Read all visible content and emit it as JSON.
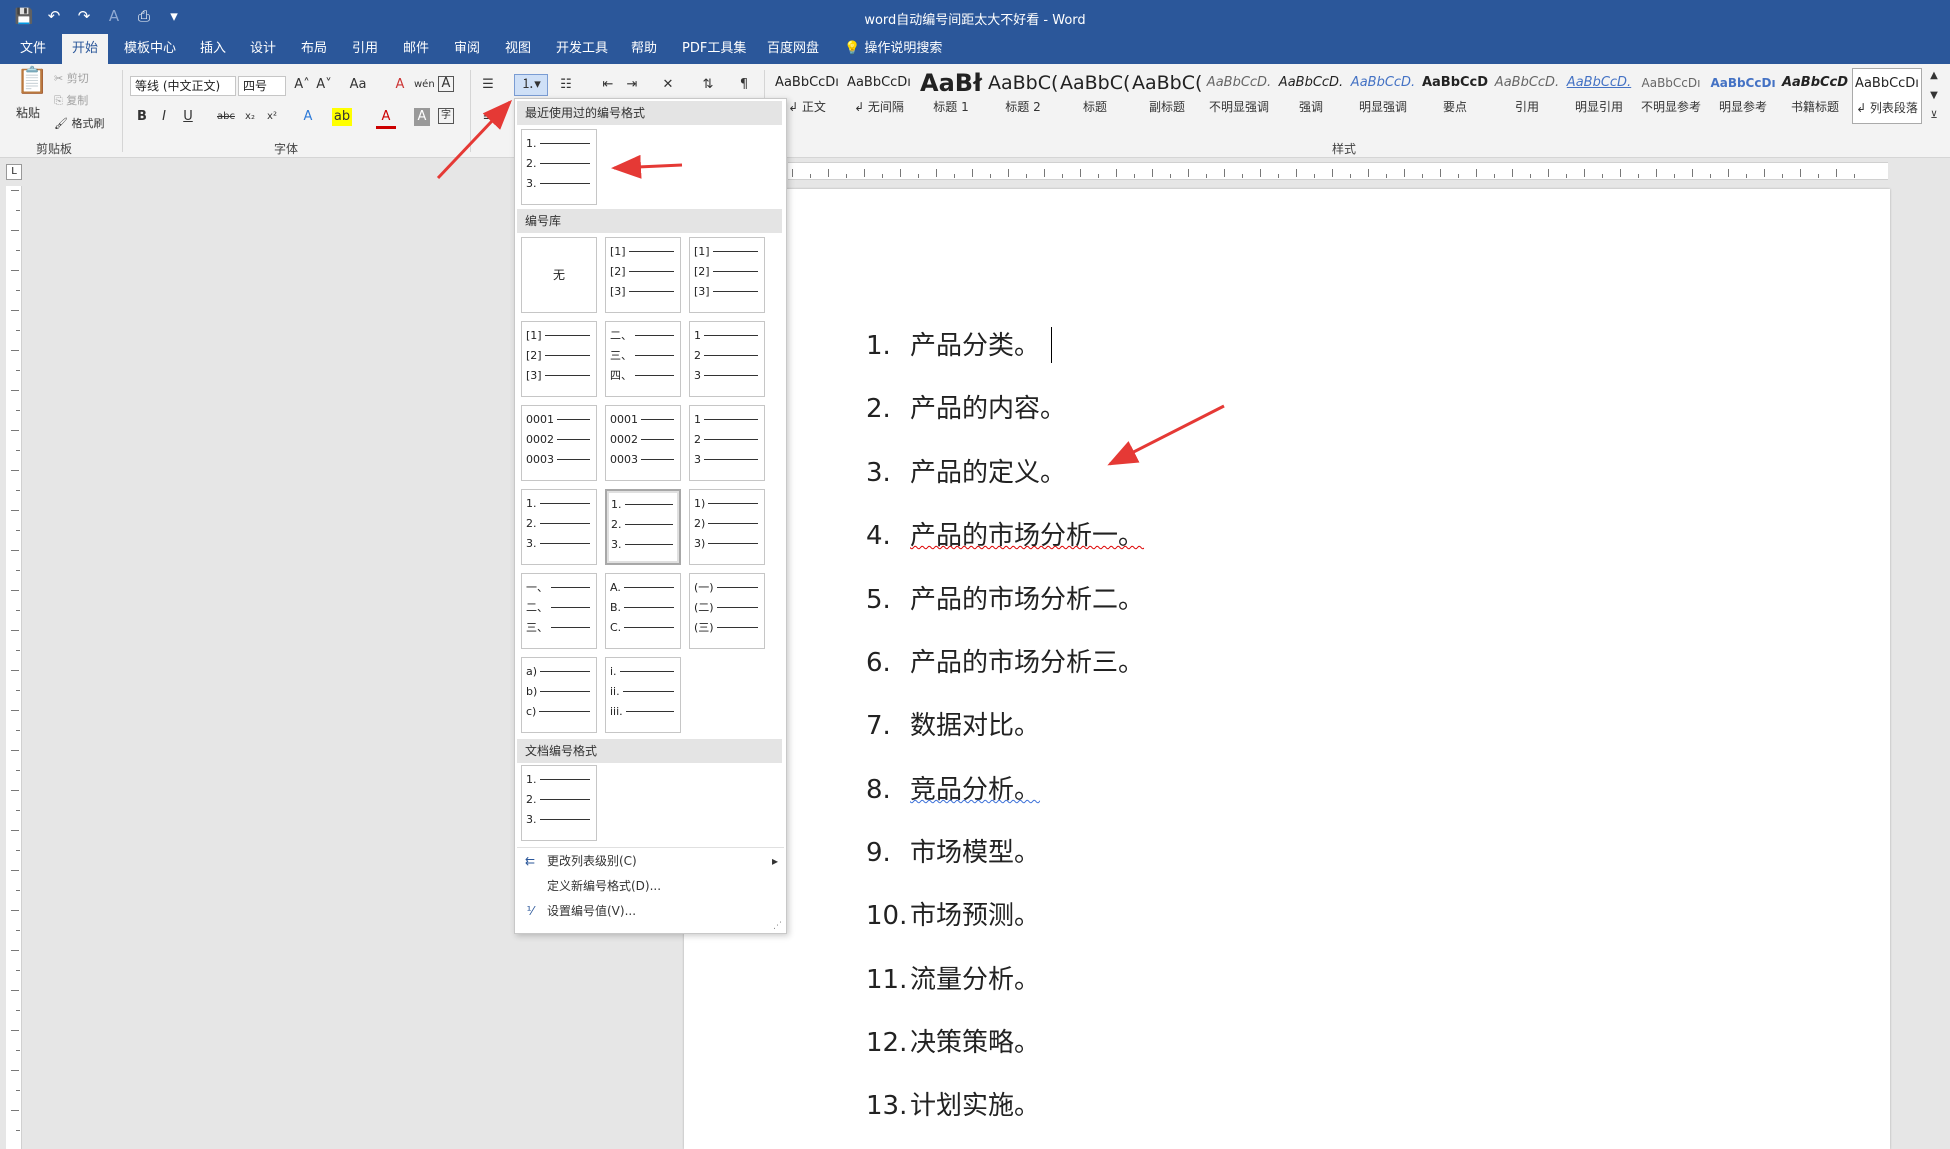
{
  "window": {
    "title": "word自动编号间距太大不好看 - Word"
  },
  "tabs": [
    {
      "label": "文件"
    },
    {
      "label": "开始"
    },
    {
      "label": "模板中心"
    },
    {
      "label": "插入"
    },
    {
      "label": "设计"
    },
    {
      "label": "布局"
    },
    {
      "label": "引用"
    },
    {
      "label": "邮件"
    },
    {
      "label": "审阅"
    },
    {
      "label": "视图"
    },
    {
      "label": "开发工具"
    },
    {
      "label": "帮助"
    },
    {
      "label": "PDF工具集"
    },
    {
      "label": "百度网盘"
    },
    {
      "label": "操作说明搜索"
    }
  ],
  "clipboard": {
    "paste": "粘贴",
    "cut": "剪切",
    "copy": "复制",
    "format_painter": "格式刷",
    "label": "剪贴板"
  },
  "font": {
    "name": "等线 (中文正文)",
    "size": "四号",
    "label": "字体"
  },
  "styles": {
    "label": "样式",
    "items": [
      {
        "sample": "AaBbCcDı",
        "name": "↲ 正文"
      },
      {
        "sample": "AaBbCcDı",
        "name": "↲ 无间隔"
      },
      {
        "sample": "AaBł",
        "name": "标题 1"
      },
      {
        "sample": "AaBbC(",
        "name": "标题 2"
      },
      {
        "sample": "AaBbC(",
        "name": "标题"
      },
      {
        "sample": "AaBbC(",
        "name": "副标题"
      },
      {
        "sample": "AaBbCcD.",
        "name": "不明显强调"
      },
      {
        "sample": "AaBbCcD.",
        "name": "强调"
      },
      {
        "sample": "AaBbCcD.",
        "name": "明显强调"
      },
      {
        "sample": "AaBbCcD",
        "name": "要点"
      },
      {
        "sample": "AaBbCcD.",
        "name": "引用"
      },
      {
        "sample": "AaBbCcD.",
        "name": "明显引用"
      },
      {
        "sample": "AaBbCcDı",
        "name": "不明显参考"
      },
      {
        "sample": "AaBbCcDı",
        "name": "明显参考"
      },
      {
        "sample": "AaBbCcD",
        "name": "书籍标题"
      },
      {
        "sample": "AaBbCcDı",
        "name": "↲ 列表段落"
      }
    ]
  },
  "numbering_dropdown": {
    "recent_header": "最近使用过的编号格式",
    "library_header": "编号库",
    "document_header": "文档编号格式",
    "none_label": "无",
    "recent": [
      [
        "1.",
        "2.",
        "3."
      ]
    ],
    "library": [
      [
        "[1]",
        "[2]",
        "[3]"
      ],
      [
        "[1]",
        "[2]",
        "[3]"
      ],
      [
        "[1]",
        "[2]",
        "[3]"
      ],
      [
        "二、",
        "三、",
        "四、"
      ],
      [
        "1",
        "2",
        "3"
      ],
      [
        "0001",
        "0002",
        "0003"
      ],
      [
        "0001",
        "0002",
        "0003"
      ],
      [
        "1",
        "2",
        "3"
      ],
      [
        "1.",
        "2.",
        "3."
      ],
      [
        "1.",
        "2.",
        "3."
      ],
      [
        "1)",
        "2)",
        "3)"
      ],
      [
        "一、",
        "二、",
        "三、"
      ],
      [
        "A.",
        "B.",
        "C."
      ],
      [
        "(一)",
        "(二)",
        "(三)"
      ],
      [
        "a)",
        "b)",
        "c)"
      ],
      [
        "i.",
        "ii.",
        "iii."
      ]
    ],
    "document": [
      [
        "1.",
        "2.",
        "3."
      ]
    ],
    "menu": [
      {
        "label": "更改列表级别(C)",
        "icon": "list-level-icon"
      },
      {
        "label": "定义新编号格式(D)...",
        "icon": ""
      },
      {
        "label": "设置编号值(V)...",
        "icon": "set-value-icon"
      }
    ]
  },
  "document": {
    "items": [
      {
        "num": "1.",
        "text": "产品分类。"
      },
      {
        "num": "2.",
        "text": "产品的内容。"
      },
      {
        "num": "3.",
        "text": "产品的定义。"
      },
      {
        "num": "4.",
        "text": "产品的市场分析一。"
      },
      {
        "num": "5.",
        "text": "产品的市场分析二。"
      },
      {
        "num": "6.",
        "text": "产品的市场分析三。"
      },
      {
        "num": "7.",
        "text": "数据对比。"
      },
      {
        "num": "8.",
        "text": "竞品分析。"
      },
      {
        "num": "9.",
        "text": "市场模型。"
      },
      {
        "num": "10.",
        "text": "市场预测。"
      },
      {
        "num": "11.",
        "text": "流量分析。"
      },
      {
        "num": "12.",
        "text": "决策策略。"
      },
      {
        "num": "13.",
        "text": "计划实施。"
      }
    ]
  },
  "colors": {
    "accent": "#2b579a",
    "annotation_arrow": "#e53935"
  }
}
